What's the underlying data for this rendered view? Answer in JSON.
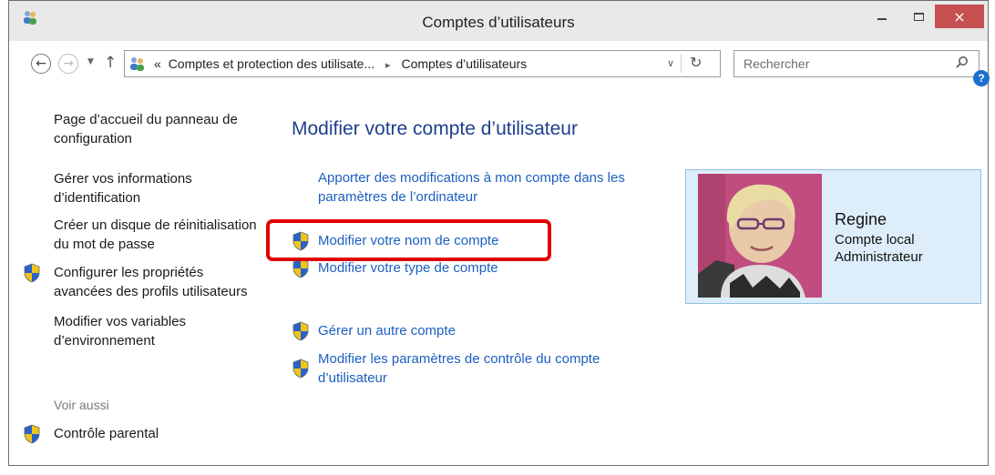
{
  "window": {
    "title": "Comptes d’utilisateurs",
    "close_glyph": "×"
  },
  "navbar": {
    "breadcrumb_prefix": "«",
    "crumbs": [
      "Comptes et protection des utilisate...",
      "Comptes d’utilisateurs"
    ],
    "crumb_separator": "▸",
    "search_placeholder": "Rechercher"
  },
  "sidebar": {
    "items": [
      "Page d’accueil du panneau de configuration",
      "Gérer vos informations d’identification",
      "Créer un disque de réinitialisation du mot de passe",
      "Configurer les propriétés avancées des profils utilisateurs",
      "Modifier vos variables d’environnement"
    ],
    "see_also_label": "Voir aussi",
    "see_also_items": [
      "Contrôle parental"
    ]
  },
  "main": {
    "title": "Modifier votre compte d’utilisateur",
    "tasks": [
      "Apporter des modifications à mon compte dans les paramètres de l’ordinateur",
      "Modifier votre nom de compte",
      "Modifier votre type de compte",
      "Gérer un autre compte",
      "Modifier les paramètres de contrôle du compte d’utilisateur"
    ]
  },
  "user": {
    "name": "Regine",
    "account_type": "Compte local",
    "role": "Administrateur"
  },
  "colors": {
    "link": "#1c5fc0",
    "title": "#1e3f8f",
    "highlight": "#e00000",
    "card_bg": "#ddeefa",
    "close_button": "#c75050"
  },
  "icons": [
    "users-icon",
    "back-arrow-icon",
    "forward-arrow-icon",
    "up-arrow-icon",
    "refresh-icon",
    "search-icon",
    "help-icon",
    "uac-shield-icon"
  ]
}
